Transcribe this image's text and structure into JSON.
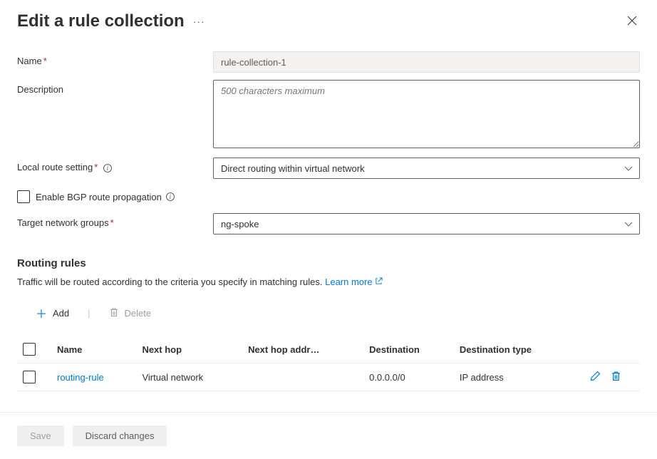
{
  "header": {
    "title": "Edit a rule collection",
    "menu": "···"
  },
  "form": {
    "name_label": "Name",
    "name_value": "rule-collection-1",
    "description_label": "Description",
    "description_placeholder": "500 characters maximum",
    "local_route_label": "Local route setting",
    "local_route_value": "Direct routing within virtual network",
    "bgp_label": "Enable BGP route propagation",
    "target_label": "Target network groups",
    "target_value": "ng-spoke"
  },
  "routing": {
    "section_title": "Routing rules",
    "description": "Traffic will be routed according to the criteria you specify in matching rules.",
    "learn_more": "Learn more",
    "add": "Add",
    "delete": "Delete",
    "columns": {
      "name": "Name",
      "next_hop": "Next hop",
      "next_hop_addr": "Next hop addr…",
      "destination": "Destination",
      "destination_type": "Destination type"
    },
    "rows": [
      {
        "name": "routing-rule",
        "next_hop": "Virtual network",
        "next_hop_addr": "",
        "destination": "0.0.0.0/0",
        "destination_type": "IP address"
      }
    ]
  },
  "footer": {
    "save": "Save",
    "discard": "Discard changes"
  }
}
